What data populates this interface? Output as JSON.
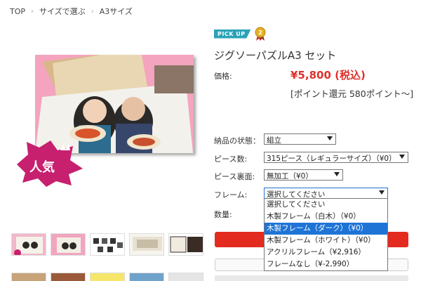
{
  "breadcrumb": {
    "home": "TOP",
    "category": "サイズで選ぶ",
    "current": "A3サイズ"
  },
  "badges": {
    "pickup": "PICK UP",
    "rank": "2",
    "ninki": "人気"
  },
  "product": {
    "title": "ジグソーパズルA3 セット"
  },
  "price": {
    "label": "価格:",
    "value": "¥5,800 (税込)",
    "points": "[ポイント還元 580ポイント〜]"
  },
  "options": {
    "delivery_state": {
      "label": "納品の状態：",
      "value": "組立"
    },
    "pieces": {
      "label": "ピース数:",
      "value": "315ピース（レギュラーサイズ）（¥0）"
    },
    "back": {
      "label": "ピース裏面:",
      "value": "無加工（¥0）"
    },
    "frame": {
      "label": "フレーム:",
      "value": "選択してください",
      "choices": [
        "選択してください",
        "木製フレーム（白木）（¥0）",
        "木製フレーム（ダーク）（¥0）",
        "木製フレーム（ホワイト）（¥0）",
        "アクリルフレーム（¥2,916）",
        "フレームなし（¥-2,990）"
      ],
      "highlighted_index": 2
    },
    "quantity": {
      "label": "数量:"
    }
  },
  "colors": {
    "accent_red": "#e32b1f",
    "pickup_teal": "#2aa3b7",
    "highlight_blue": "#1e74d6"
  }
}
